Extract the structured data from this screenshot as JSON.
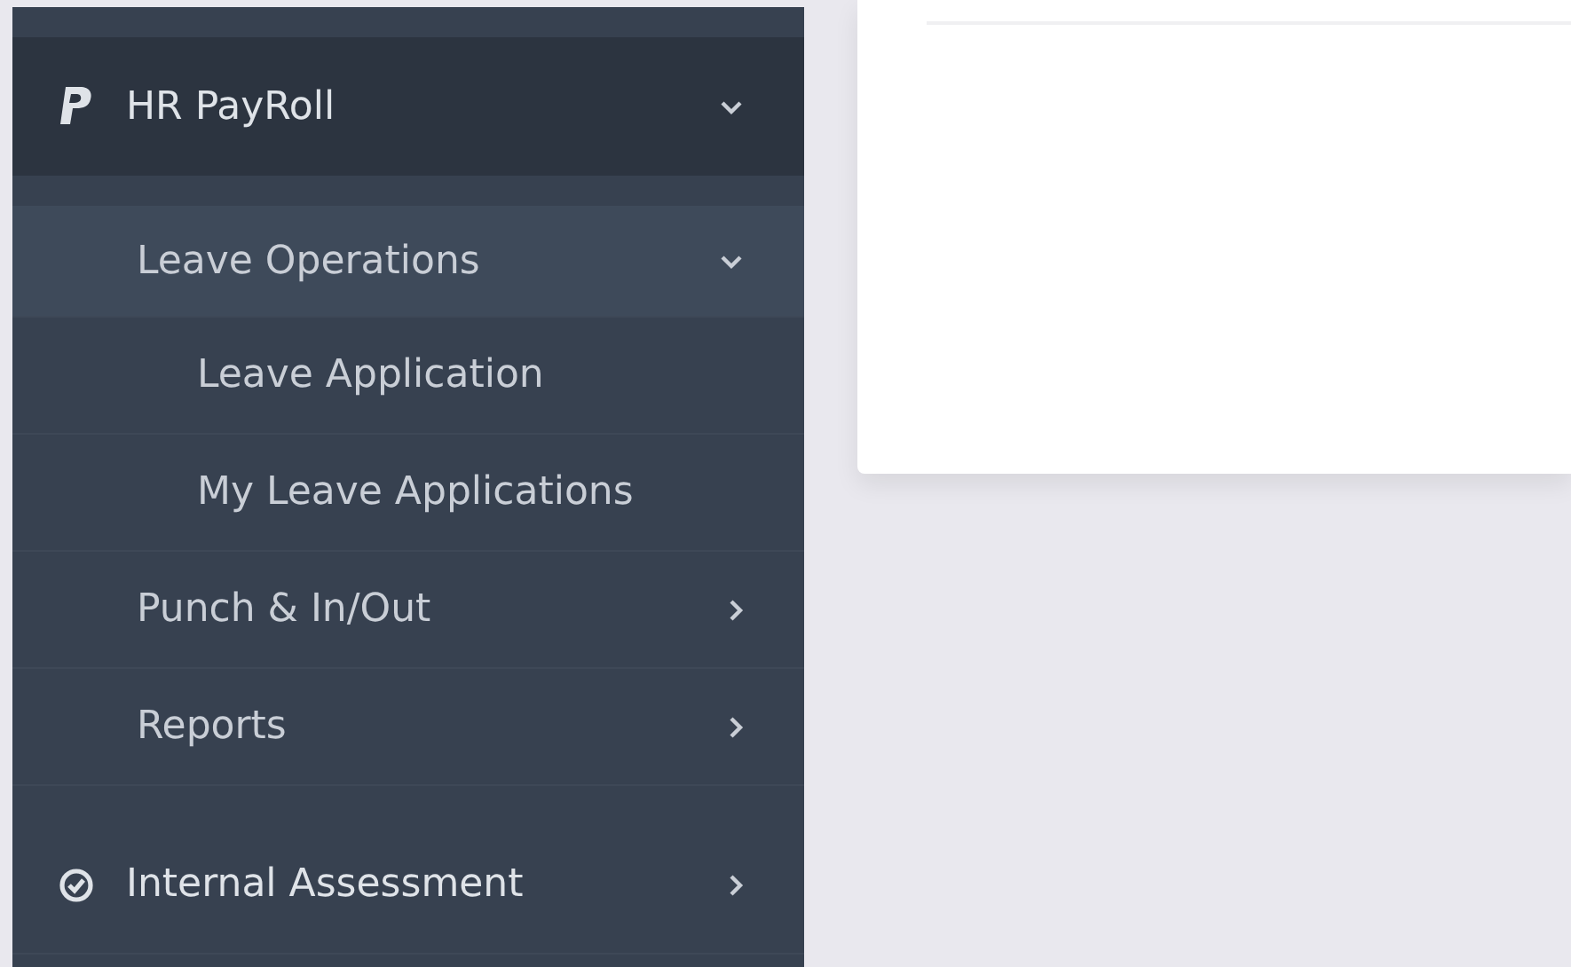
{
  "sidebar": {
    "items": [
      {
        "label": "HR PayRoll",
        "expanded": true,
        "children": [
          {
            "label": "Leave Operations",
            "expanded": true,
            "children": [
              {
                "label": "Leave Application"
              },
              {
                "label": "My Leave Applications"
              }
            ]
          },
          {
            "label": "Punch & In/Out",
            "expanded": false
          },
          {
            "label": "Reports",
            "expanded": false
          }
        ]
      },
      {
        "label": "Internal Assessment",
        "expanded": false
      }
    ]
  }
}
